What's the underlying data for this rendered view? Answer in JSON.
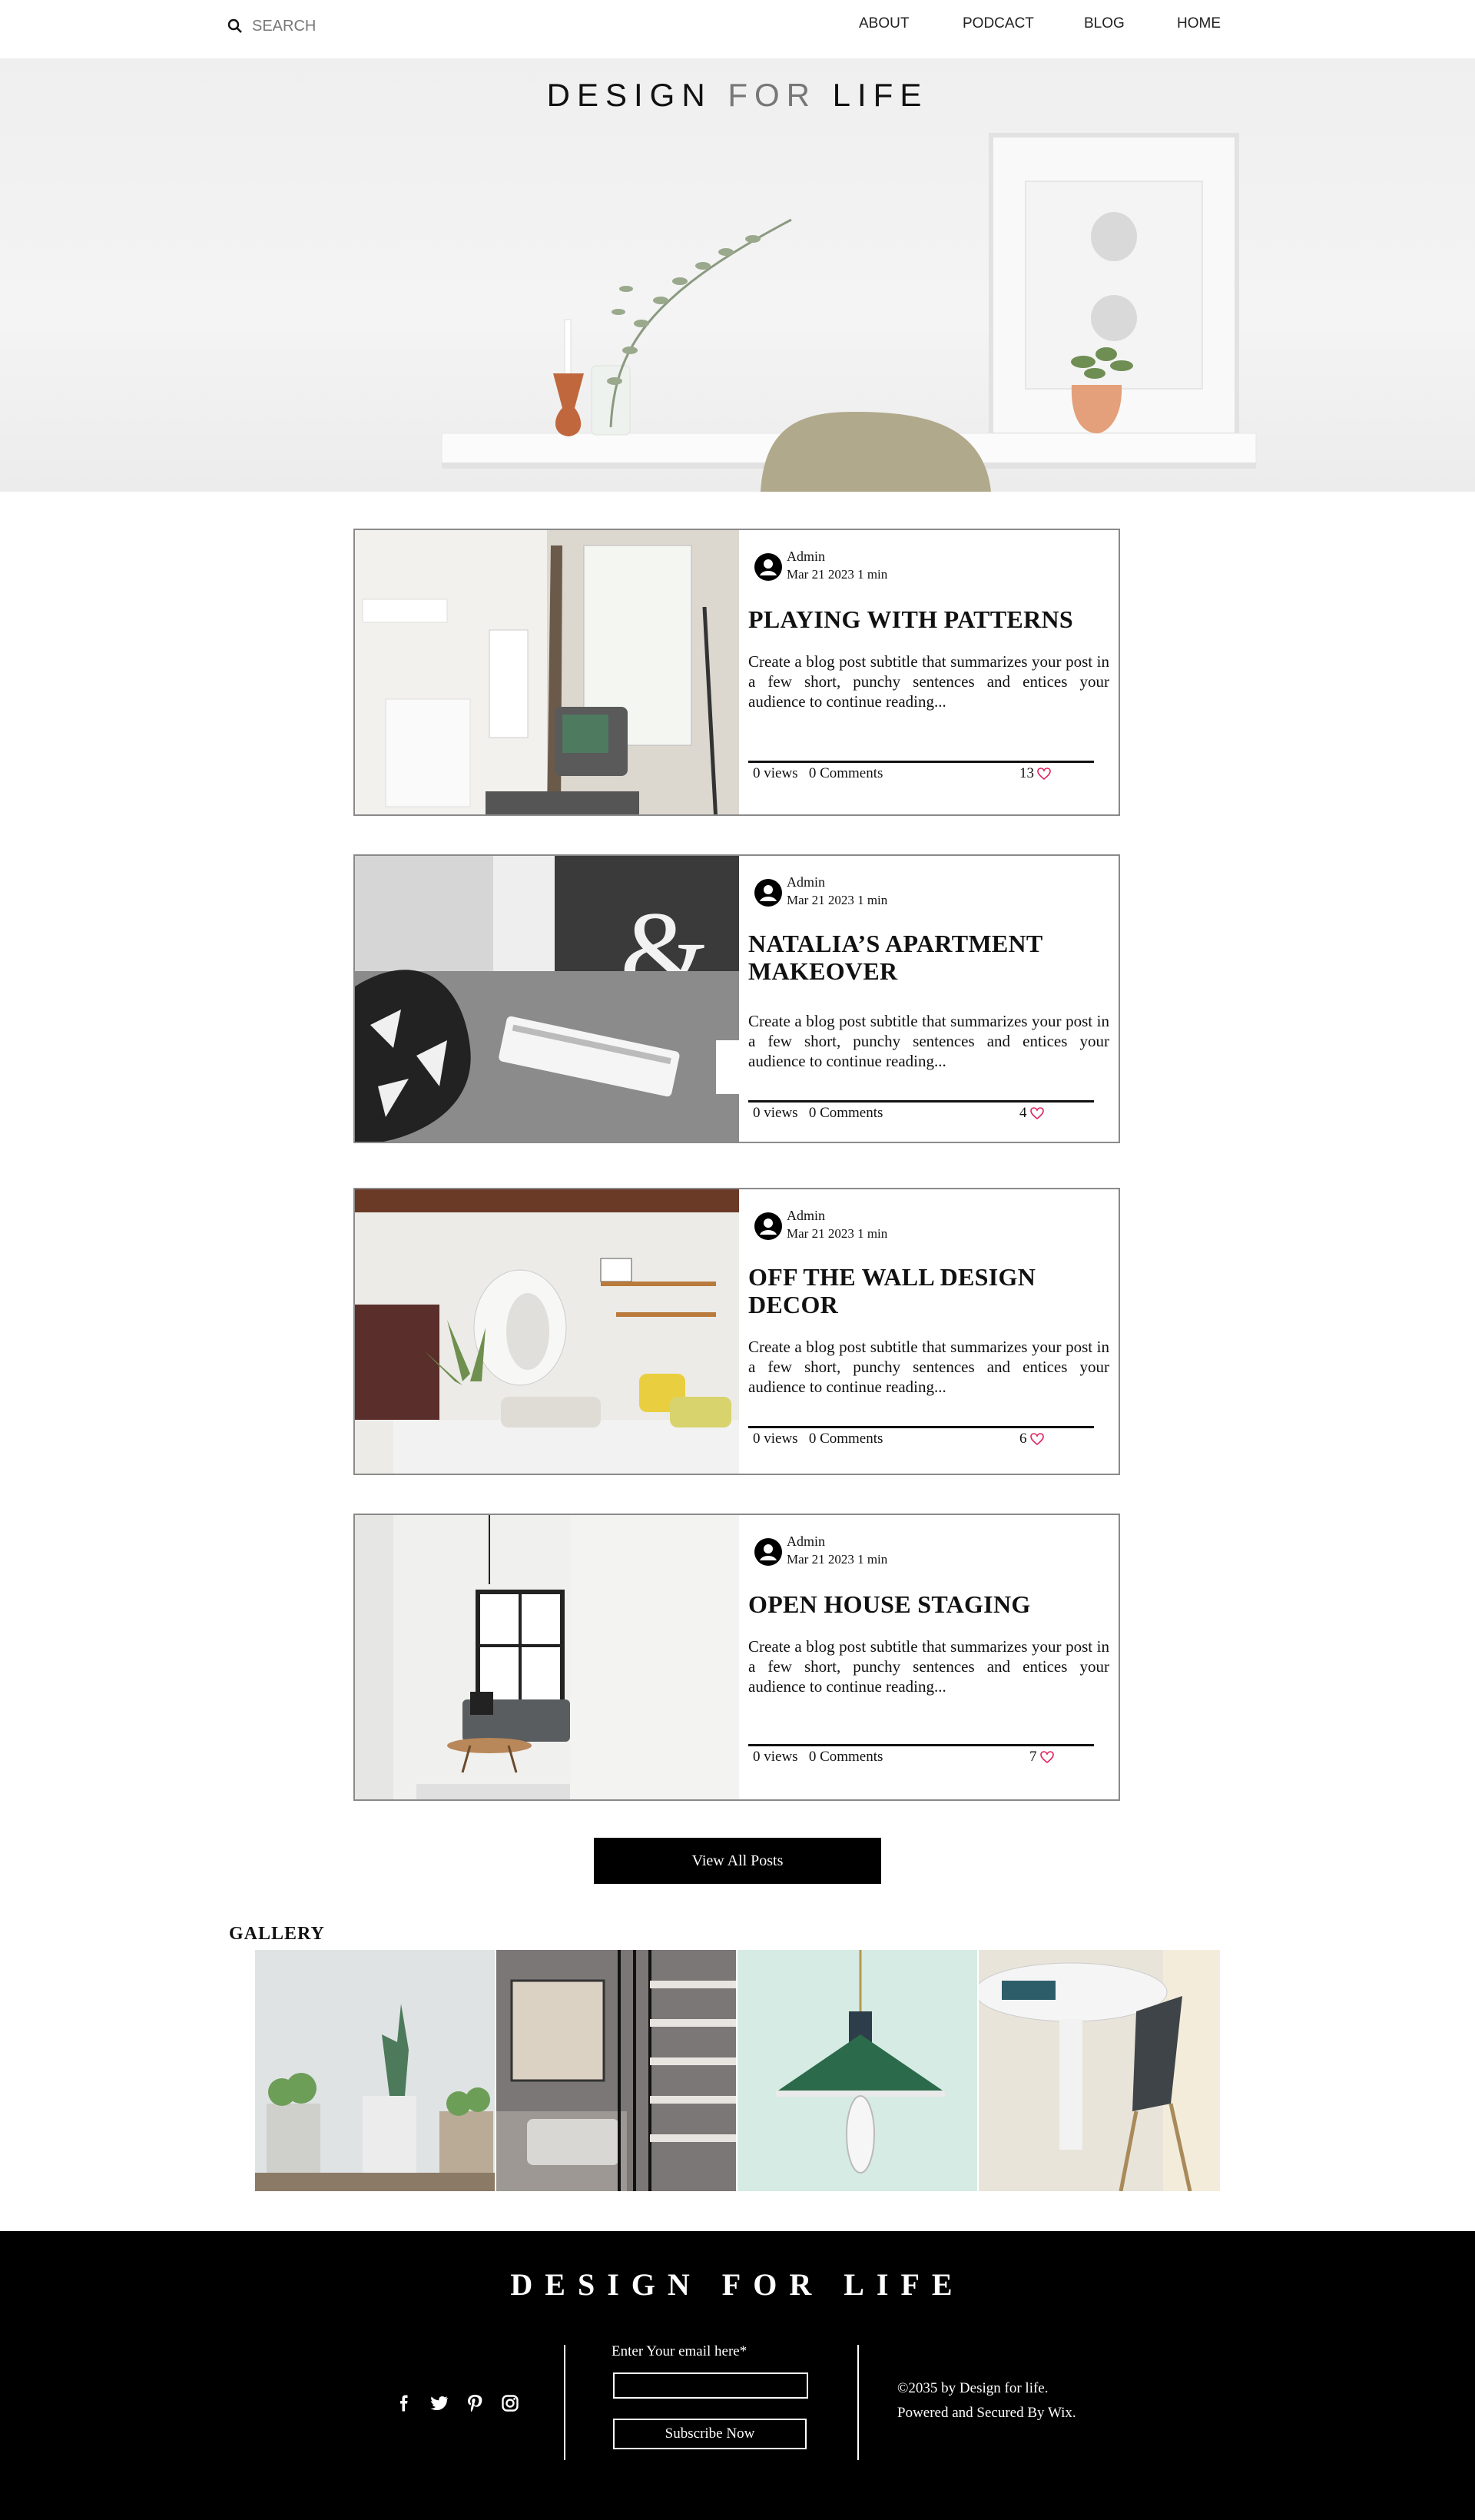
{
  "search": {
    "placeholder": "SEARCH"
  },
  "nav": {
    "items": [
      "ABOUT",
      "PODCACT",
      "BLOG",
      "HOME"
    ]
  },
  "hero": {
    "title_part1": "DESIGN",
    "title_part2": "FOR",
    "title_part3": "LIFE"
  },
  "posts": [
    {
      "author": "Admin",
      "meta": "Mar 21 2023 1 min",
      "title": "PLAYING WITH PATTERNS",
      "excerpt": "Create a blog post subtitle that summarizes your post in a few short, punchy sentences and entices your audience to continue reading...",
      "views": "0 views",
      "comments": "0 Comments",
      "likes": "13"
    },
    {
      "author": "Admin",
      "meta": "Mar 21 2023 1 min",
      "title": "NATALIA’S APARTMENT MAKEOVER",
      "excerpt": "Create a blog post subtitle that summarizes your post in a few short, punchy sentences and entices your audience to continue reading...",
      "views": "0 views",
      "comments": "0 Comments",
      "likes": "4"
    },
    {
      "author": "Admin",
      "meta": "Mar 21 2023 1 min",
      "title": "OFF THE WALL DESIGN DECOR",
      "excerpt": "Create a blog post subtitle that summarizes your post in a few short, punchy sentences and entices your audience to continue reading...",
      "views": "0 views",
      "comments": "0 Comments",
      "likes": "6"
    },
    {
      "author": "Admin",
      "meta": "Mar 21 2023 1 min",
      "title": "OPEN HOUSE STAGING",
      "excerpt": "Create a blog post subtitle that summarizes your post in a few short, punchy sentences and entices your audience to continue reading...",
      "views": "0 views",
      "comments": "0 Comments",
      "likes": "7"
    }
  ],
  "view_all_label": "View All Posts",
  "gallery": {
    "title": "GALLERY"
  },
  "footer": {
    "title": "DESIGN FOR LIFE",
    "email_label": "Enter Your email here*",
    "subscribe_label": "Subscribe Now",
    "copyright": "©2035 by Design for life.",
    "powered": "Powered and Secured By Wix.",
    "social_icons": [
      "facebook-icon",
      "twitter-icon",
      "pinterest-icon",
      "instagram-icon"
    ]
  },
  "colors": {
    "like_heart": "#e0245e",
    "footer_bg": "#000000",
    "button_bg": "#000000"
  }
}
